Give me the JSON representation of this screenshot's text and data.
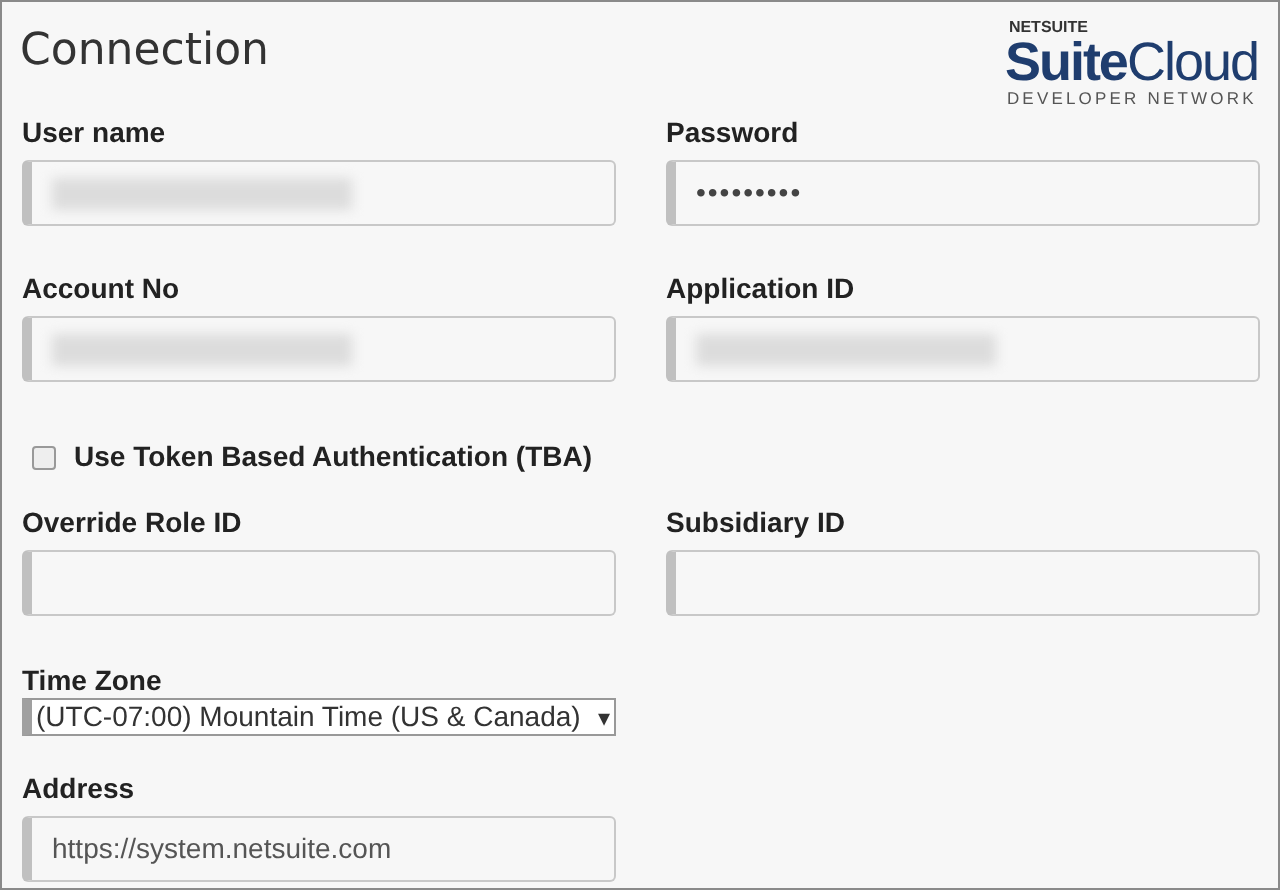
{
  "title": "Connection",
  "logo": {
    "brand": "NETSUITE",
    "product": "**Suite**Cloud",
    "tagline": "DEVELOPER NETWORK"
  },
  "rows": [
    {
      "fields": [
        {
          "label": "User name",
          "kind": "redacted"
        },
        {
          "label": "Password",
          "kind": "password",
          "value": "•••••••••"
        }
      ]
    },
    {
      "fields": [
        {
          "label": "Account No",
          "kind": "redacted"
        },
        {
          "label": "Application ID",
          "kind": "redacted"
        }
      ]
    }
  ],
  "tba": {
    "label": "Use Token Based Authentication (TBA)",
    "checked": false
  },
  "rows2": [
    {
      "fields": [
        {
          "label": "Override Role ID",
          "kind": "empty"
        },
        {
          "label": "Subsidiary ID",
          "kind": "empty"
        }
      ]
    },
    {
      "fields": [
        {
          "label": "Time Zone",
          "kind": "select",
          "value": "(UTC-07:00) Mountain Time (US & Canada)",
          "arrow": "▾"
        }
      ]
    },
    {
      "fields": [
        {
          "label": "Address",
          "kind": "text",
          "value": "https://system.netsuite.com"
        }
      ]
    }
  ]
}
